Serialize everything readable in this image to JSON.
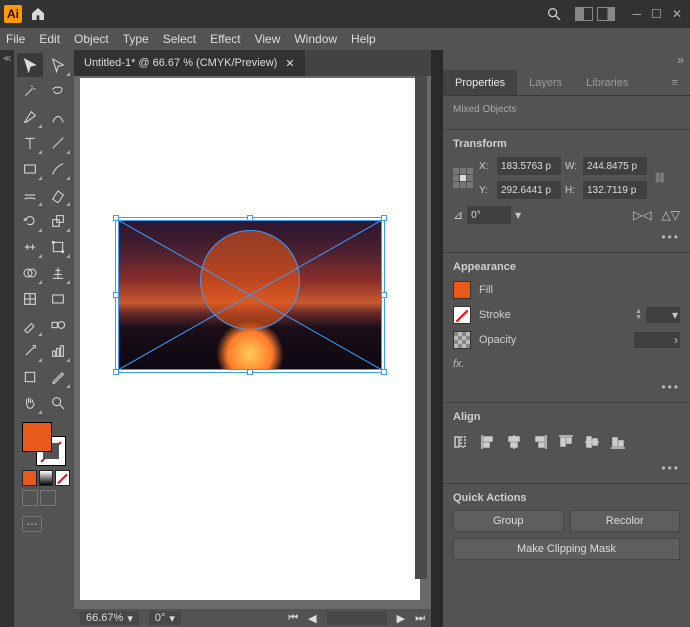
{
  "menu": {
    "file": "File",
    "edit": "Edit",
    "object": "Object",
    "type": "Type",
    "select": "Select",
    "effect": "Effect",
    "view": "View",
    "window": "Window",
    "help": "Help"
  },
  "tabs": {
    "doc": "Untitled-1* @ 66.67 % (CMYK/Preview)"
  },
  "status": {
    "zoom": "66.67%",
    "angle": "0°"
  },
  "panel": {
    "tabs": {
      "properties": "Properties",
      "layers": "Layers",
      "libraries": "Libraries"
    },
    "selection": "Mixed Objects",
    "transform": {
      "head": "Transform",
      "x_label": "X:",
      "x": "183.5763 p",
      "y_label": "Y:",
      "y": "292.6441 p",
      "w_label": "W:",
      "w": "244.8475 p",
      "h_label": "H:",
      "h": "132.7119 p",
      "angle": "0°"
    },
    "appearance": {
      "head": "Appearance",
      "fill": "Fill",
      "stroke": "Stroke",
      "opacity": "Opacity",
      "fx": "fx."
    },
    "align": {
      "head": "Align"
    },
    "quick": {
      "head": "Quick Actions",
      "group": "Group",
      "recolor": "Recolor",
      "clip": "Make Clipping Mask"
    }
  },
  "colors": {
    "fill": "#e85a19"
  }
}
